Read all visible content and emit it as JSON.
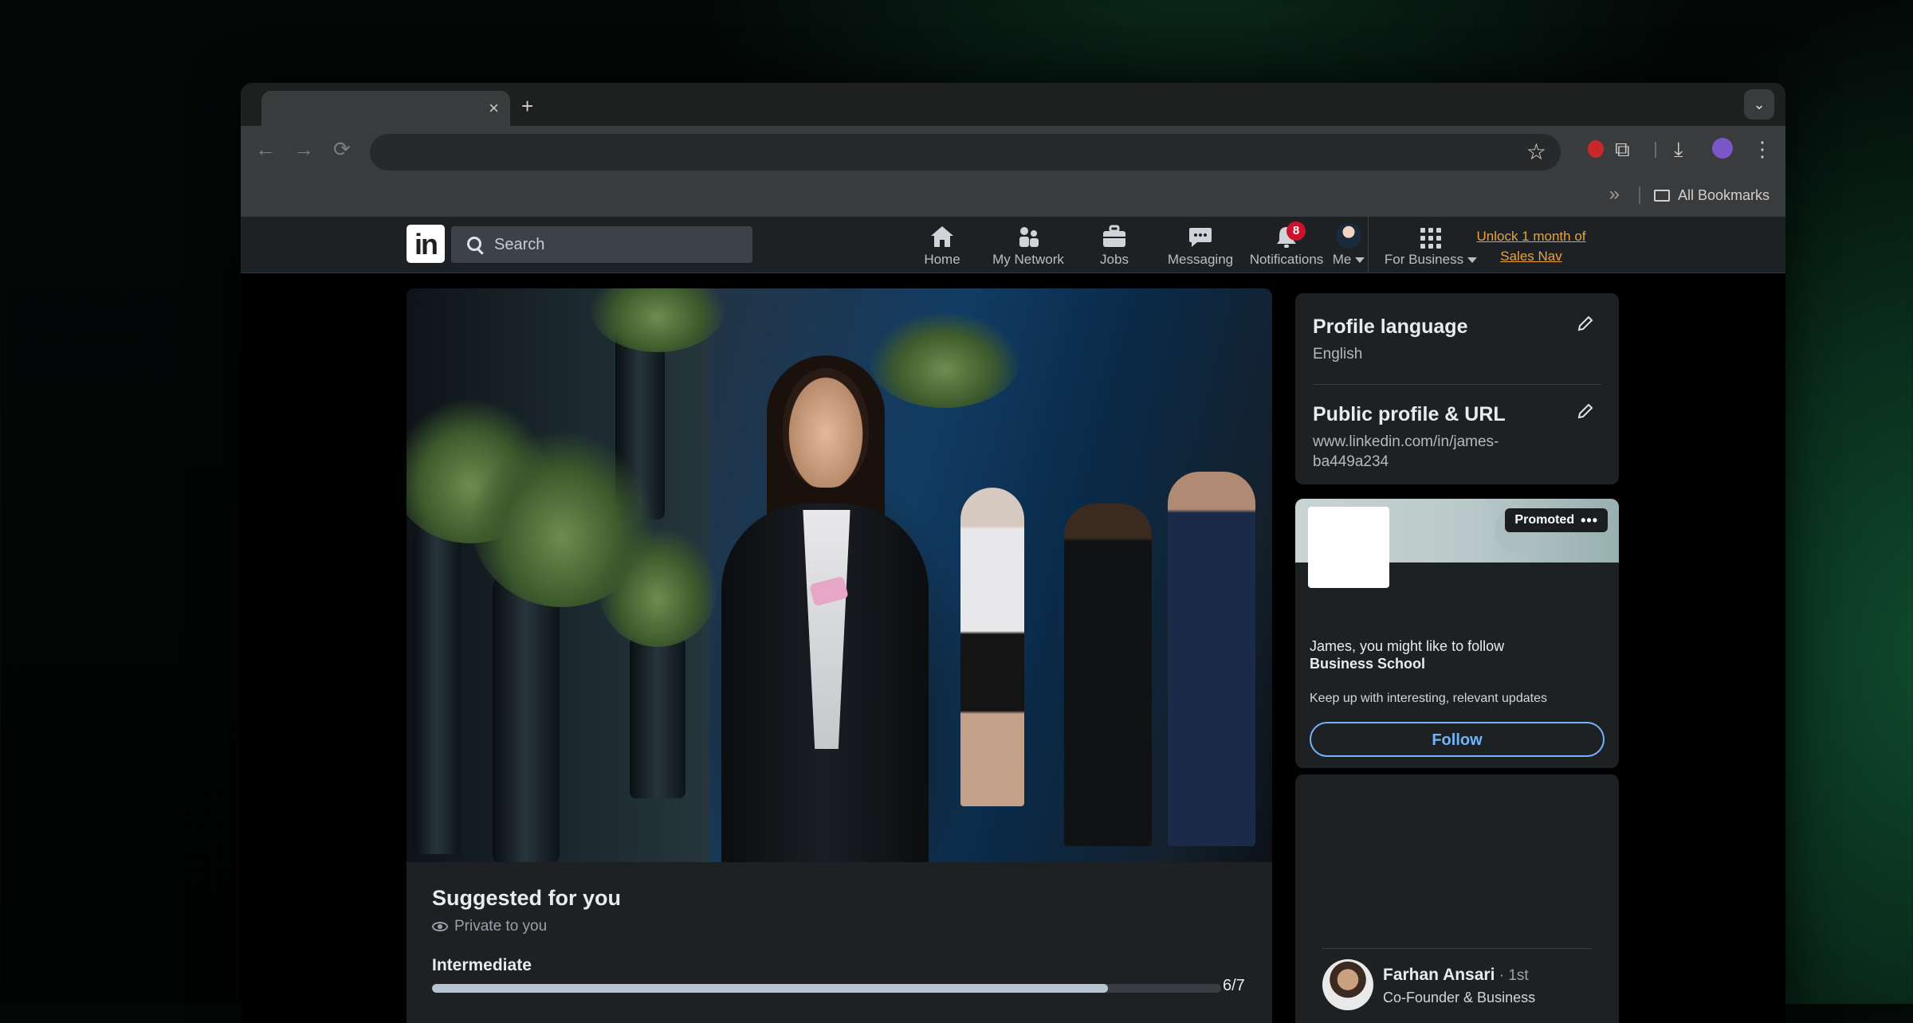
{
  "browser": {
    "tab_close": "×",
    "new_tab": "+",
    "tab_menu": "⌄",
    "back": "←",
    "forward": "→",
    "reload": "⟳",
    "bookmark_star": "☆",
    "bookmarks_overflow": "»",
    "all_bookmarks": "All Bookmarks"
  },
  "nav": {
    "search_placeholder": "Search",
    "items": [
      {
        "label": "Home"
      },
      {
        "label": "My Network"
      },
      {
        "label": "Jobs"
      },
      {
        "label": "Messaging"
      },
      {
        "label": "Notifications",
        "badge": "8"
      },
      {
        "label": "Me"
      },
      {
        "label": "For Business"
      }
    ],
    "sales_nav": "Unlock 1 month of Sales Nav"
  },
  "suggested": {
    "title": "Suggested for you",
    "privacy": "Private to you",
    "level": "Intermediate",
    "progress_count": "6/7",
    "progress_fraction": 0.857
  },
  "profile_card": {
    "language_title": "Profile language",
    "language_value": "English",
    "url_title": "Public profile & URL",
    "url_value": "www.linkedin.com/in/james-\nba449a234"
  },
  "promo_card": {
    "promoted": "Promoted",
    "more": "•••",
    "message": "James, you might like to follow",
    "company": "Business School",
    "keep_up": "Keep up with interesting, relevant updates",
    "follow": "Follow"
  },
  "people_card": {
    "name": "Farhan Ansari",
    "degree": " · 1st",
    "title": "Co-Founder & Business"
  },
  "colors": {
    "linkedin_blue": "#70b5f9",
    "notification_red": "#cb112d",
    "sales_nav_gold": "#e7a33e"
  }
}
